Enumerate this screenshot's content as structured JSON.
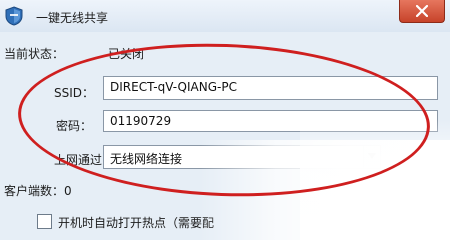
{
  "window": {
    "title": "一键无线共享"
  },
  "status": {
    "label": "当前状态：",
    "value": "已关闭"
  },
  "ssid": {
    "label": "SSID：",
    "value": "DIRECT-qV-QIANG-PC"
  },
  "password": {
    "label": "密码：",
    "value": "01190729"
  },
  "uplink": {
    "label": "上网通过：",
    "value": "无线网络连接"
  },
  "clients": {
    "label": "客户端数：0"
  },
  "autostart": {
    "label": "开机时自动打开热点（需要配"
  },
  "colors": {
    "annotation_ellipse": "#cf1f1f",
    "close_button": "#c7432a"
  },
  "icons": {
    "app": "app-shield-icon",
    "close": "close-icon",
    "dropdown": "chevron-down-icon"
  }
}
